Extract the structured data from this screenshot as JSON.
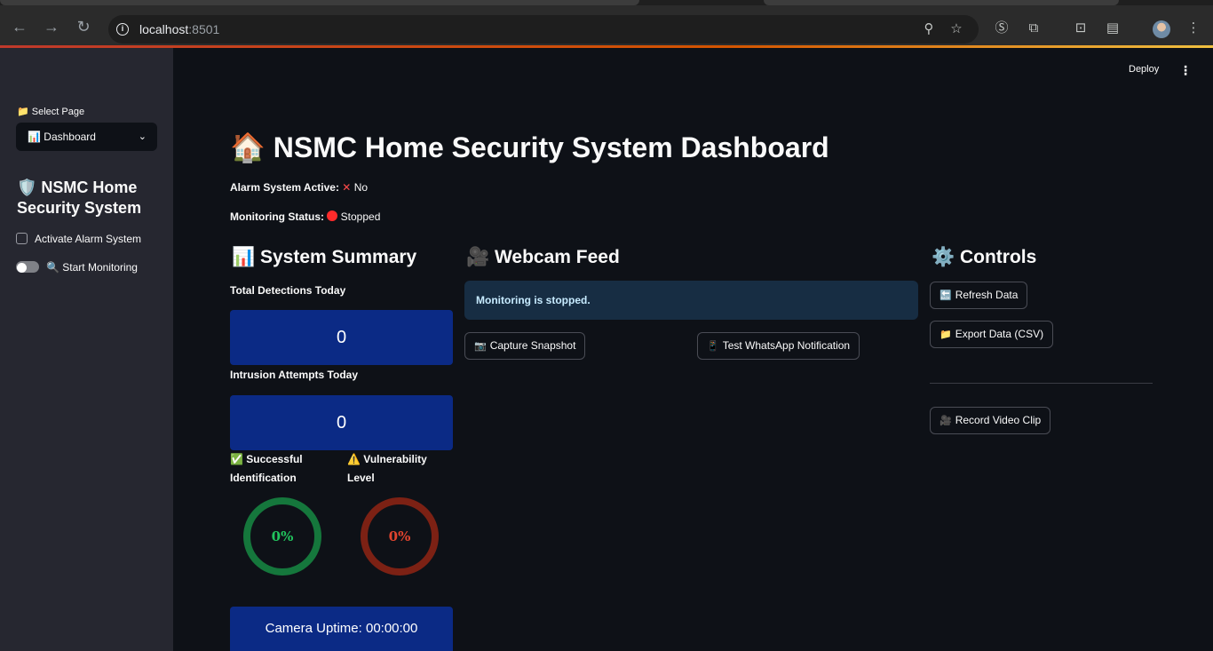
{
  "browser": {
    "url_host": "localhost",
    "url_port": ":8501"
  },
  "sidebar": {
    "select_label": "📁 Select Page",
    "select_value": "📊 Dashboard",
    "title": "🛡️ NSMC Home Security System",
    "checkbox_label": "Activate Alarm System",
    "toggle_label": "🔍 Start Monitoring"
  },
  "header": {
    "deploy_label": "Deploy"
  },
  "main": {
    "title": "🏠 NSMC Home Security System Dashboard",
    "alarm_label": "Alarm System Active:",
    "alarm_value": "No",
    "monitoring_label": "Monitoring Status:",
    "monitoring_value": "Stopped"
  },
  "summary": {
    "heading": "📊 System Summary",
    "detections_label": "Total Detections Today",
    "detections_value": "0",
    "intrusions_label": "Intrusion Attempts Today",
    "intrusions_value": "0",
    "success_label": "✅ Successful Identification",
    "success_value": "0%",
    "vuln_label": "⚠️ Vulnerability Level",
    "vuln_value": "0%",
    "uptime": "Camera Uptime: 00:00:00"
  },
  "webcam": {
    "heading": "🎥 Webcam Feed",
    "info": "Monitoring is stopped.",
    "snapshot_label": "Capture Snapshot",
    "whatsapp_label": "Test WhatsApp Notification"
  },
  "controls": {
    "heading": "⚙️ Controls",
    "refresh_label": "Refresh Data",
    "export_label": "Export Data (CSV)",
    "record_label": "Record Video Clip"
  },
  "colors": {
    "metric_bg": "#0b2a85",
    "success_ring": "#15773c",
    "vuln_ring": "#7c2114",
    "sidebar_bg": "#262730",
    "main_bg": "#0e1117"
  }
}
